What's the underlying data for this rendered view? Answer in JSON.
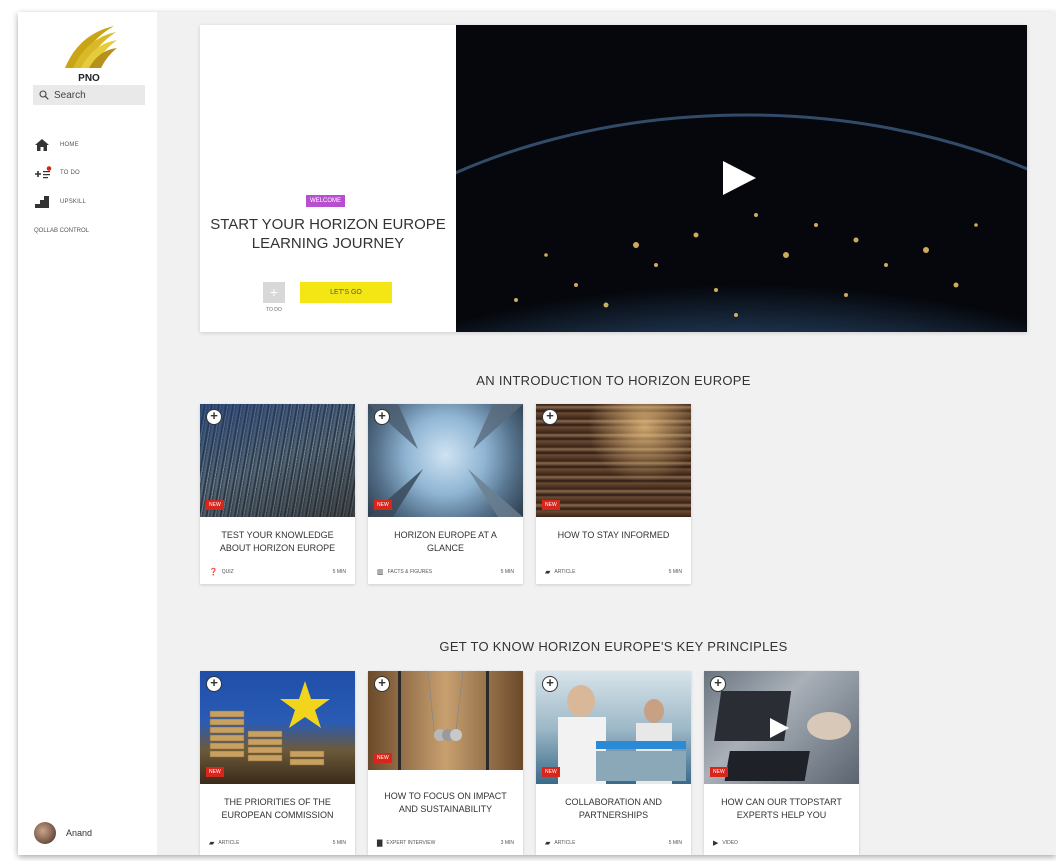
{
  "brand": {
    "logo_text": "PNO"
  },
  "search": {
    "placeholder": "Search"
  },
  "nav": {
    "home": "HOME",
    "todo": "TO DO",
    "upskill": "UPSKILL",
    "qollab": "QOLLAB CONTROL"
  },
  "user": {
    "name": "Anand"
  },
  "hero": {
    "tag": "WELCOME",
    "title_line1": "START YOUR HORIZON EUROPE",
    "title_line2": "LEARNING JOURNEY",
    "todo_button": "+",
    "todo_label": "TO DO",
    "cta": "LET'S GO"
  },
  "sections": [
    {
      "title": "AN INTRODUCTION TO HORIZON EUROPE",
      "cards": [
        {
          "title": "TEST YOUR KNOWLEDGE ABOUT HORIZON EUROPE",
          "badge": "NEW",
          "type": "QUIZ",
          "type_icon": "question-icon",
          "duration": "5 MIN"
        },
        {
          "title": "HORIZON EUROPE AT A GLANCE",
          "badge": "NEW",
          "type": "FACTS & FIGURES",
          "type_icon": "bar-chart-icon",
          "duration": "5 MIN"
        },
        {
          "title": "HOW TO STAY INFORMED",
          "badge": "NEW",
          "type": "ARTICLE",
          "type_icon": "book-icon",
          "duration": "5 MIN"
        }
      ]
    },
    {
      "title": "GET TO KNOW HORIZON EUROPE'S KEY PRINCIPLES",
      "cards": [
        {
          "title": "THE PRIORITIES OF THE EUROPEAN COMMISSION",
          "badge": "NEW",
          "type": "ARTICLE",
          "type_icon": "book-icon",
          "duration": "5 MIN"
        },
        {
          "title": "HOW TO FOCUS ON IMPACT AND SUSTAINABILITY",
          "badge": "NEW",
          "type": "EXPERT INTERVIEW",
          "type_icon": "chat-icon",
          "duration": "3 MIN"
        },
        {
          "title": "COLLABORATION AND PARTNERSHIPS",
          "badge": "NEW",
          "type": "ARTICLE",
          "type_icon": "book-icon",
          "duration": "5 MIN"
        },
        {
          "title": "HOW CAN OUR TTOPSTART EXPERTS HELP YOU",
          "badge": "NEW",
          "type": "VIDEO",
          "type_icon": "play-icon",
          "duration": ""
        }
      ]
    }
  ],
  "colors": {
    "accent_yellow": "#f3e614",
    "welcome_purple": "#b84fd0",
    "badge_red": "#d9261c"
  }
}
